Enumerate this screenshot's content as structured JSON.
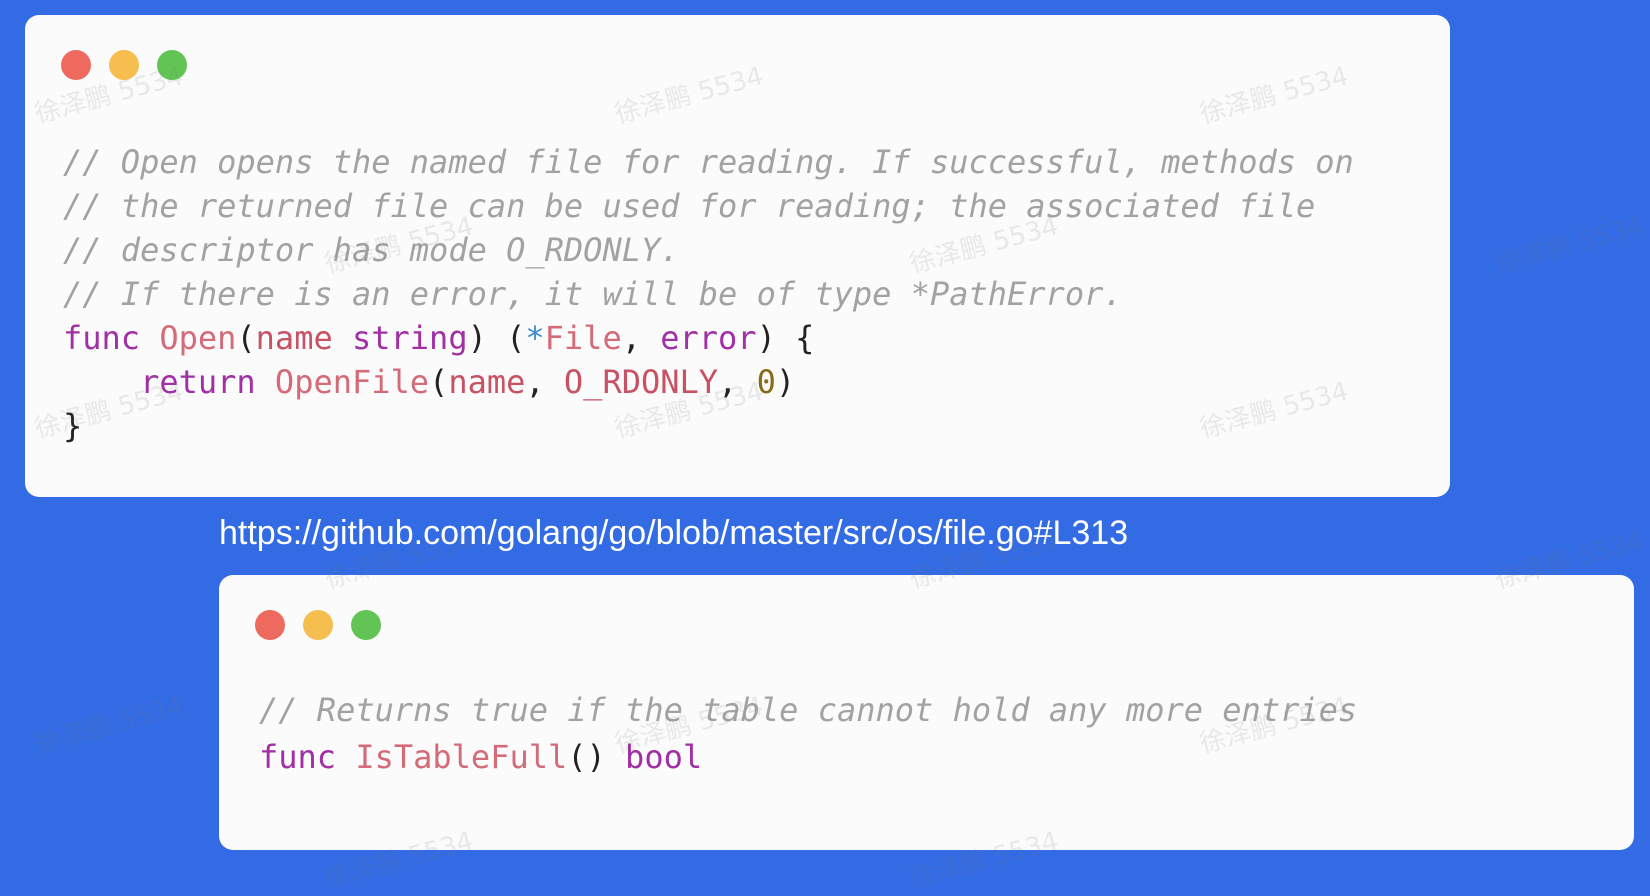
{
  "top_snippet": {
    "lines": [
      [
        {
          "t": "// Open opens the named file for reading. If successful, methods on",
          "k": "comment"
        }
      ],
      [
        {
          "t": "// the returned file can be used for reading; the associated file",
          "k": "comment"
        }
      ],
      [
        {
          "t": "// descriptor has mode O_RDONLY.",
          "k": "comment"
        }
      ],
      [
        {
          "t": "// If there is an error, it will be of type *PathError.",
          "k": "comment"
        }
      ],
      [
        {
          "t": "func",
          "k": "keyword"
        },
        {
          "t": " ",
          "k": "punct"
        },
        {
          "t": "Open",
          "k": "func"
        },
        {
          "t": "(",
          "k": "punct"
        },
        {
          "t": "name",
          "k": "param"
        },
        {
          "t": " ",
          "k": "punct"
        },
        {
          "t": "string",
          "k": "type"
        },
        {
          "t": ") (",
          "k": "punct"
        },
        {
          "t": "*",
          "k": "op"
        },
        {
          "t": "File",
          "k": "func"
        },
        {
          "t": ", ",
          "k": "punct"
        },
        {
          "t": "error",
          "k": "type"
        },
        {
          "t": ") {",
          "k": "punct"
        }
      ],
      [
        {
          "t": "    ",
          "k": "punct"
        },
        {
          "t": "return",
          "k": "keyword"
        },
        {
          "t": " ",
          "k": "punct"
        },
        {
          "t": "OpenFile",
          "k": "func"
        },
        {
          "t": "(",
          "k": "punct"
        },
        {
          "t": "name",
          "k": "param"
        },
        {
          "t": ", ",
          "k": "punct"
        },
        {
          "t": "O_RDONLY",
          "k": "param"
        },
        {
          "t": ", ",
          "k": "punct"
        },
        {
          "t": "0",
          "k": "number"
        },
        {
          "t": ")",
          "k": "punct"
        }
      ],
      [
        {
          "t": "}",
          "k": "punct"
        }
      ]
    ]
  },
  "source_link": {
    "text": "https://github.com/golang/go/blob/master/src/os/file.go#L313"
  },
  "bottom_snippet": {
    "lines": [
      [
        {
          "t": "// Returns true if the table cannot hold any more entries",
          "k": "comment"
        }
      ],
      [
        {
          "t": "func",
          "k": "keyword"
        },
        {
          "t": " ",
          "k": "punct"
        },
        {
          "t": "IsTableFull",
          "k": "func"
        },
        {
          "t": "() ",
          "k": "punct"
        },
        {
          "t": "bool",
          "k": "type"
        }
      ]
    ]
  },
  "watermark": {
    "text": "徐泽鹏 5534"
  },
  "colors": {
    "background": "#336BE4",
    "card": "#FBFBFB",
    "traffic_red": "#EE6A5F",
    "traffic_yellow": "#F5BE4F",
    "traffic_green": "#61C454",
    "comment": "#A2A2A2",
    "keyword": "#A030A3",
    "function": "#D36B78"
  }
}
